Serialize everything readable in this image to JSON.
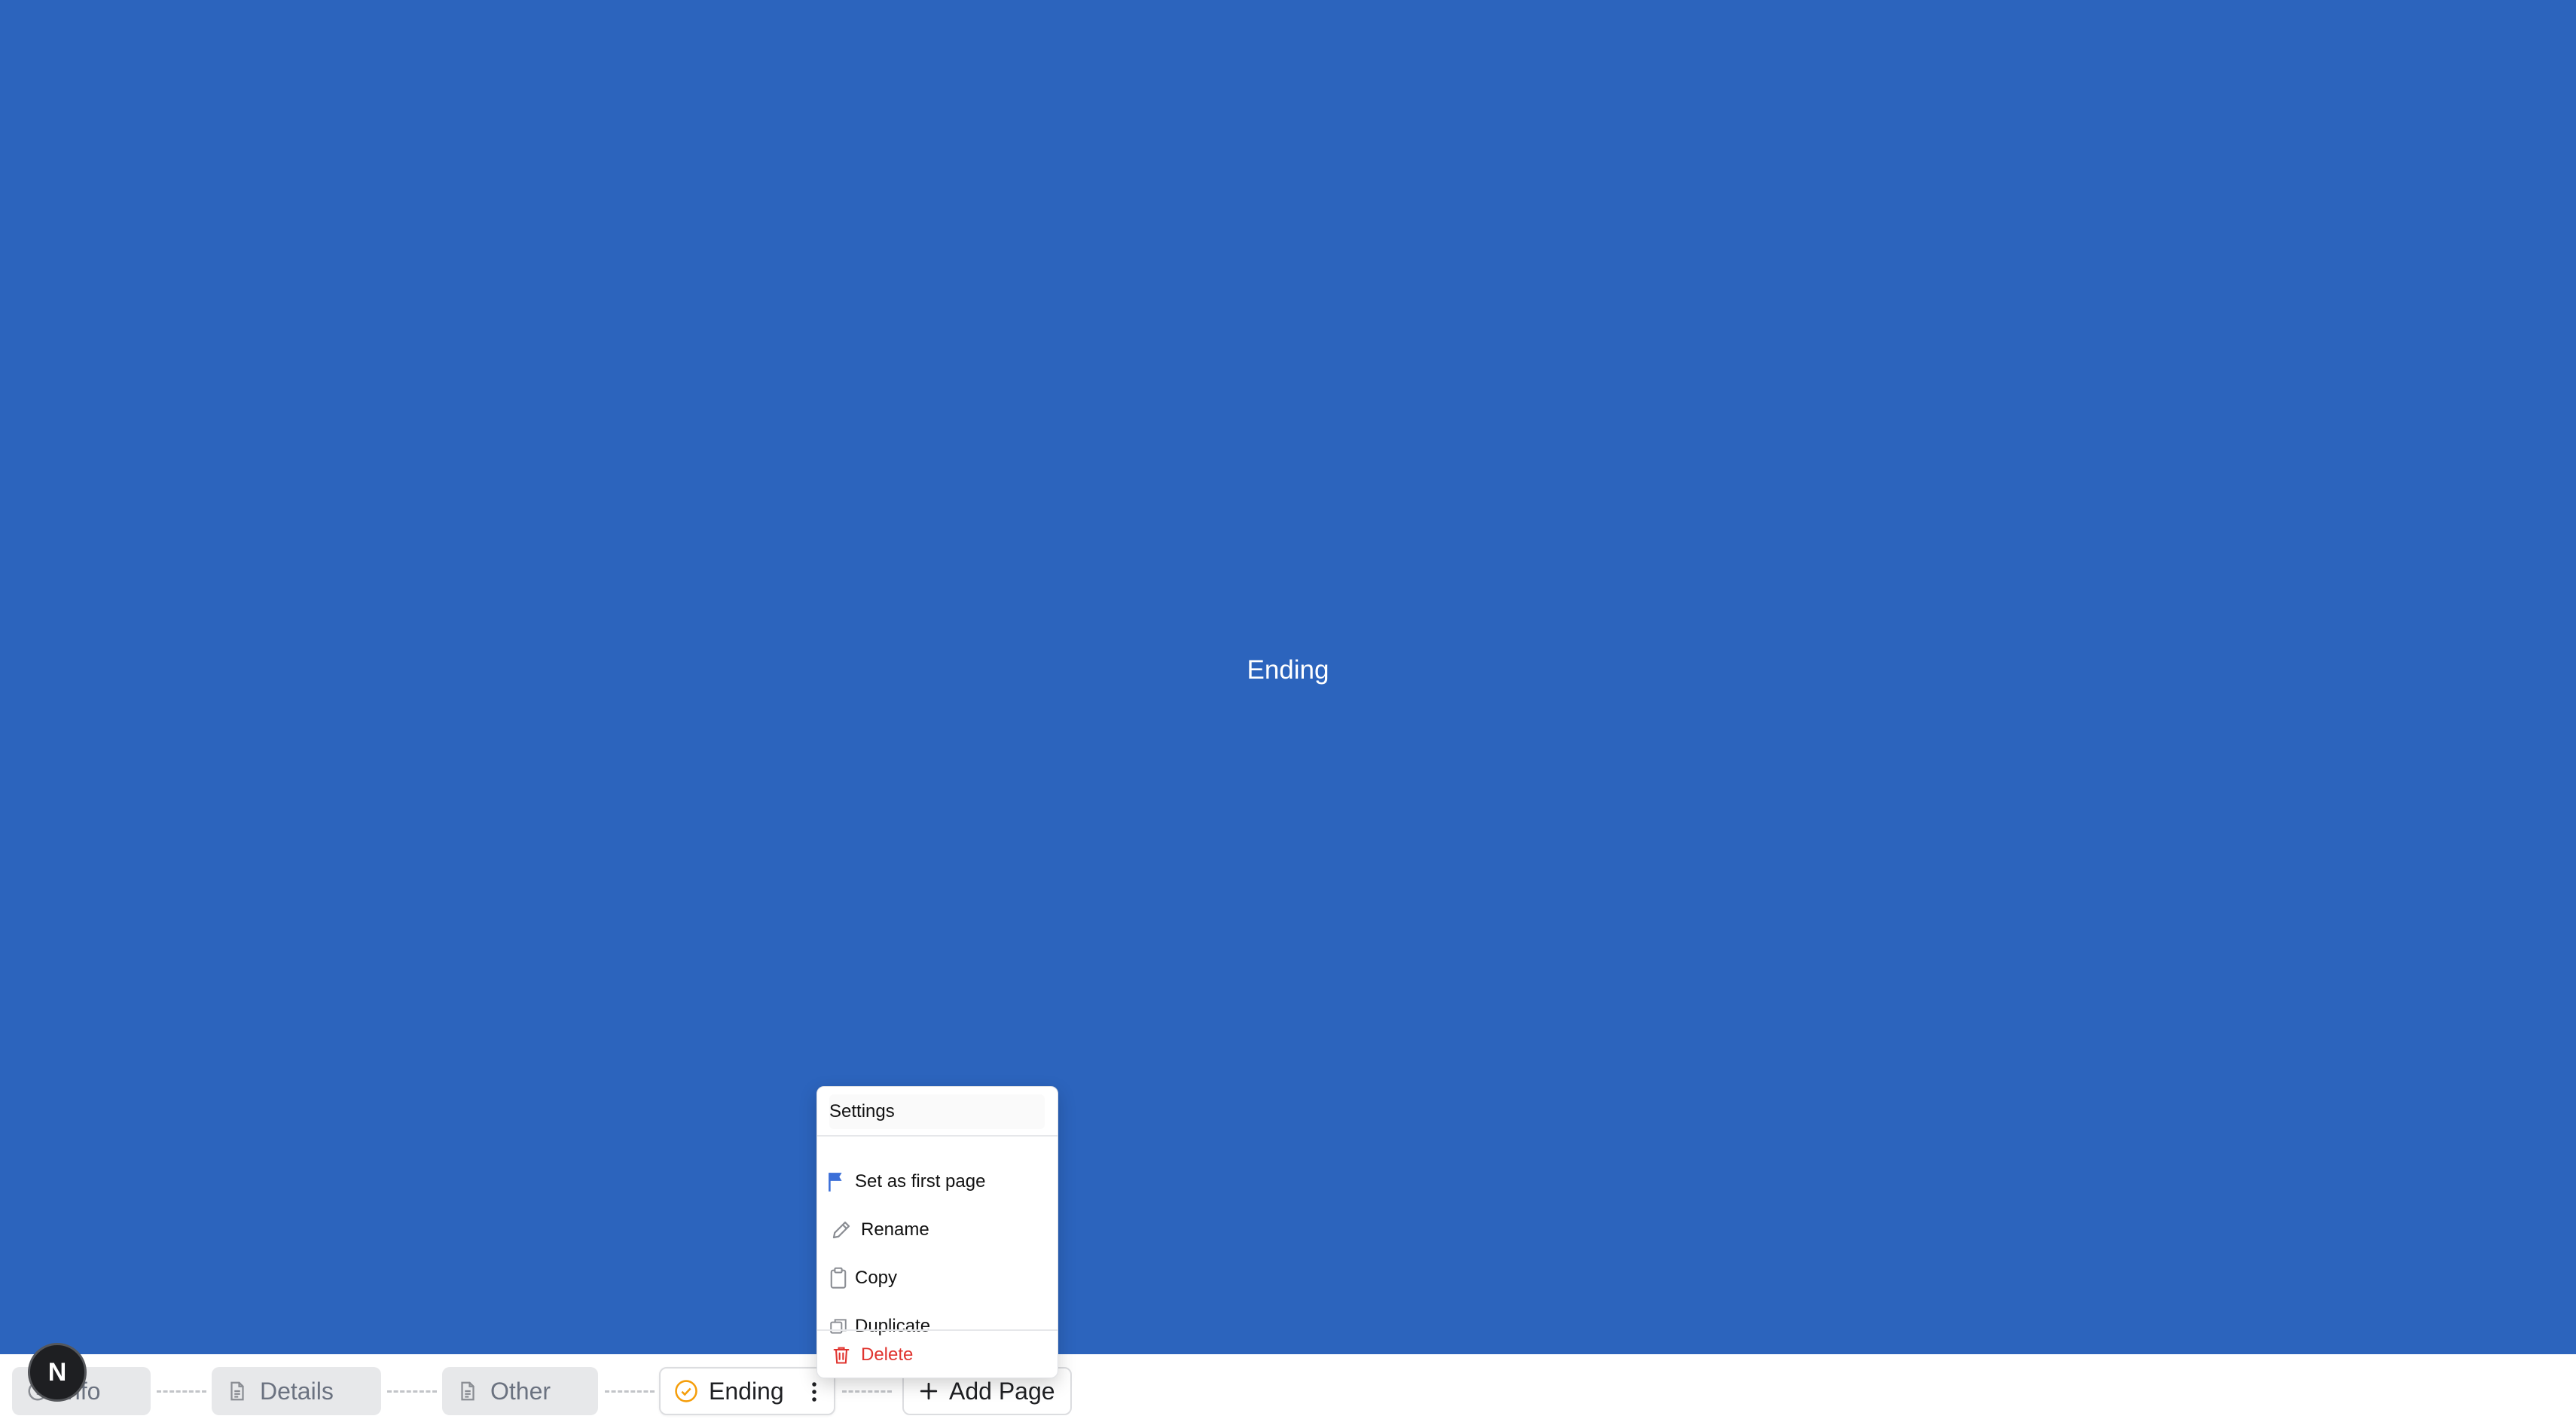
{
  "canvas": {
    "title": "Ending",
    "background": "#2c64bd"
  },
  "pages": [
    {
      "label": "Info",
      "icon": "info-icon",
      "state": "inactive"
    },
    {
      "label": "Details",
      "icon": "document-icon",
      "state": "inactive"
    },
    {
      "label": "Other",
      "icon": "document-icon",
      "state": "inactive"
    },
    {
      "label": "Ending",
      "icon": "check-circle-icon",
      "state": "active"
    }
  ],
  "add_page": {
    "label": "Add Page",
    "icon": "plus-icon"
  },
  "avatar": {
    "letter": "N"
  },
  "context_menu": {
    "header": "Settings",
    "items": [
      {
        "label": "Set as first page",
        "icon": "flag-icon"
      },
      {
        "label": "Rename",
        "icon": "pencil-icon"
      },
      {
        "label": "Copy",
        "icon": "clipboard-icon"
      },
      {
        "label": "Duplicate",
        "icon": "duplicate-icon"
      },
      {
        "label": "Delete",
        "icon": "trash-icon",
        "variant": "danger"
      }
    ]
  },
  "colors": {
    "accent": "#2c64bd",
    "active_check": "#f59e0b",
    "flag": "#3b6fd8",
    "danger": "#e0342f"
  }
}
